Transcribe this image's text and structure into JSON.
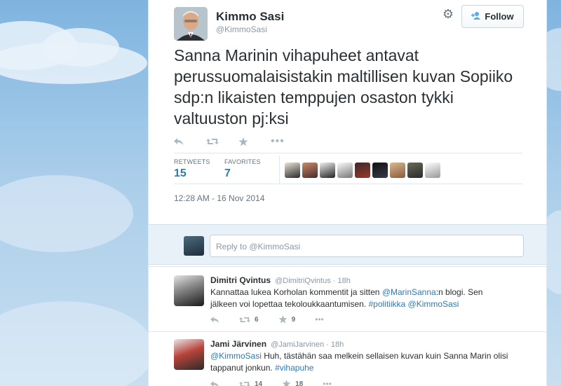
{
  "tweet": {
    "author_name": "Kimmo Sasi",
    "author_handle": "@KimmoSasi",
    "follow_label": "Follow",
    "text": "Sanna Marinin vihapuheet antavat perussuomalaisistakin maltillisen kuvan Sopiiko sdp:n likaisten temppujen osaston tykki valtuuston pj:ksi",
    "retweets_label": "RETWEETS",
    "retweets_count": "15",
    "favorites_label": "FAVORITES",
    "favorites_count": "7",
    "timestamp": "12:28 AM - 16 Nov 2014",
    "action_icons": [
      "reply-icon",
      "retweet-icon",
      "star-icon",
      "more-icon"
    ]
  },
  "reply_box": {
    "placeholder": "Reply to @KimmoSasi"
  },
  "replies": [
    {
      "name": "Dimitri Qvintus",
      "handle": "@DimitriQvintus",
      "time": "· 18h",
      "line1_a": "Kannattaa lukea Korholan kommentit ja sitten ",
      "line1_mention": "@MarinSanna",
      "line1_b": ":n blogi. Sen",
      "line2_a": "jälkeen voi lopettaa tekoloukkaantumisen. ",
      "line2_tag": "#politiikka",
      "line2_mention": "@KimmoSasi",
      "retweets": "6",
      "favorites": "9"
    },
    {
      "name": "Jami Järvinen",
      "handle": "@JamiJarvinen",
      "time": "· 18h",
      "line1_mention": "@KimmoSasi",
      "line1_b": " Huh, tästähän saa melkein sellaisen kuvan kuin Sanna Marin olisi",
      "line2_a": "tappanut jonkun. ",
      "line2_tag": "#vihapuhe",
      "retweets": "14",
      "favorites": "18"
    }
  ],
  "colors": {
    "link": "#2b7bb9",
    "muted": "#8899a6",
    "reply_zone": "#e8f1f8"
  }
}
